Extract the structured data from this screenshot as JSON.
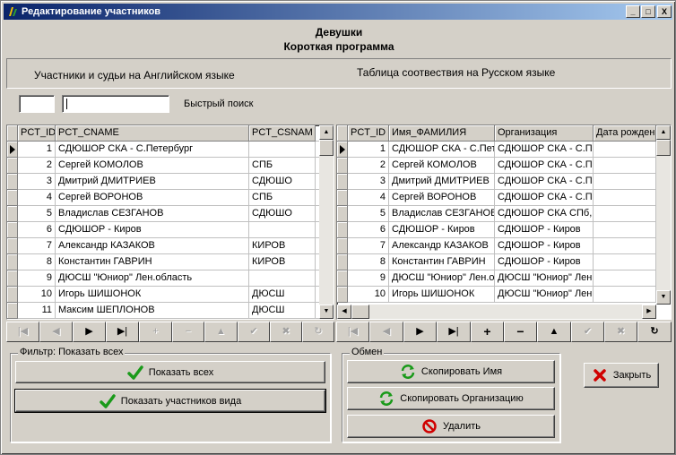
{
  "window": {
    "title": "Редактирование участников",
    "controls": {
      "minimize": "_",
      "maximize": "□",
      "close": "X"
    }
  },
  "header": {
    "line1": "Девушки",
    "line2": "Короткая программа"
  },
  "lang": {
    "left": "Участники и судьи на Английском языке",
    "right": "Таблица соотвествия на Русском языке"
  },
  "search": {
    "id_value": "",
    "name_value": "",
    "label": "Быстрый поиск"
  },
  "left_grid": {
    "columns": [
      "PCT_ID",
      "PCT_CNAME",
      "PCT_CSNAM"
    ],
    "rows": [
      [
        "1",
        "СДЮШОР СКА - С.Петербург",
        ""
      ],
      [
        "2",
        "Сергей КОМОЛОВ",
        "СПБ"
      ],
      [
        "3",
        "Дмитрий ДМИТРИЕВ",
        "СДЮШО"
      ],
      [
        "4",
        "Сергей ВОРОНОВ",
        "СПБ"
      ],
      [
        "5",
        "Владислав СЕЗГАНОВ",
        "СДЮШО"
      ],
      [
        "6",
        "СДЮШОР - Киров",
        ""
      ],
      [
        "7",
        "Александр КАЗАКОВ",
        "КИРОВ"
      ],
      [
        "8",
        "Константин ГАВРИН",
        "КИРОВ"
      ],
      [
        "9",
        "ДЮСШ \"Юниор\" Лен.область",
        ""
      ],
      [
        "10",
        "Игорь ШИШОНОК",
        "ДЮСШ"
      ],
      [
        "11",
        "Максим ШЕПЛОНОВ",
        "ДЮСШ"
      ]
    ]
  },
  "right_grid": {
    "columns": [
      "PCT_ID",
      "Имя_ФАМИЛИЯ",
      "Организация",
      "Дата рожден"
    ],
    "rows": [
      [
        "1",
        "СДЮШОР СКА - С.Пете",
        "СДЮШОР СКА - С.Пет",
        ""
      ],
      [
        "2",
        "Сергей КОМОЛОВ",
        "СДЮШОР СКА - С.Пет",
        ""
      ],
      [
        "3",
        "Дмитрий ДМИТРИЕВ",
        "СДЮШОР СКА - С.Пет",
        ""
      ],
      [
        "4",
        "Сергей ВОРОНОВ",
        "СДЮШОР СКА - С.Пет",
        ""
      ],
      [
        "5",
        "Владислав СЕЗГАНОВ",
        "СДЮШОР СКА СПб, С",
        ""
      ],
      [
        "6",
        "СДЮШОР - Киров",
        "СДЮШОР - Киров",
        ""
      ],
      [
        "7",
        "Александр КАЗАКОВ",
        "СДЮШОР - Киров",
        ""
      ],
      [
        "8",
        "Константин ГАВРИН",
        "СДЮШОР - Киров",
        ""
      ],
      [
        "9",
        "ДЮСШ \"Юниор\" Лен.об",
        "ДЮСШ \"Юниор\" Лен.о",
        ""
      ],
      [
        "10",
        "Игорь ШИШОНОК",
        "ДЮСШ \"Юниор\" Лен.о",
        ""
      ]
    ]
  },
  "nav": {
    "first": "|◀",
    "prior": "◀",
    "next": "▶",
    "last": "▶|",
    "insert": "+",
    "delete": "−",
    "edit": "▲",
    "post": "✔",
    "cancel": "✖",
    "refresh": "↻"
  },
  "filter": {
    "title": "Фильтр: Показать всех",
    "show_all": "Показать всех",
    "show_type": "Показать участников вида"
  },
  "exchange": {
    "title": "Обмен",
    "copy_name": "Скопировать Имя",
    "copy_org": "Скопировать Организацию",
    "delete": "Удалить"
  },
  "close_button": "Закрыть",
  "colors": {
    "title_start": "#0a246a",
    "title_end": "#a6caf0",
    "face": "#d4d0c8",
    "check": "#1a9a1a",
    "close_x": "#d00000"
  }
}
